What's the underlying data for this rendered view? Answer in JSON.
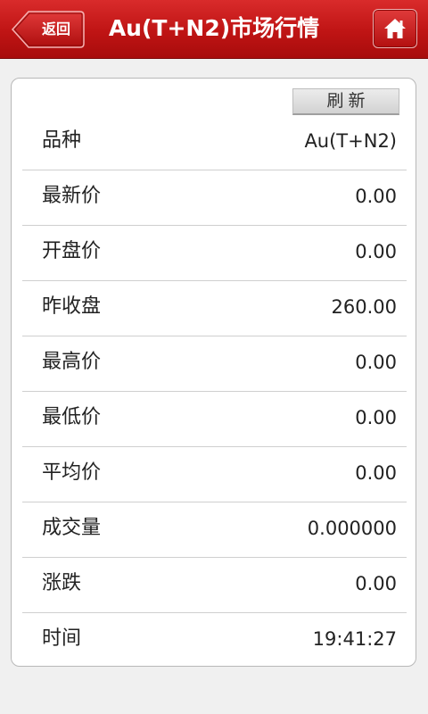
{
  "header": {
    "back_label": "返回",
    "title": "Au(T+N2)市场行情",
    "home_icon": "home-icon",
    "bar_color": "#c41a1a"
  },
  "card": {
    "refresh_label": "刷新",
    "rows": [
      {
        "label": "品种",
        "value": "Au(T+N2)"
      },
      {
        "label": "最新价",
        "value": "0.00"
      },
      {
        "label": "开盘价",
        "value": "0.00"
      },
      {
        "label": "昨收盘",
        "value": "260.00"
      },
      {
        "label": "最高价",
        "value": "0.00"
      },
      {
        "label": "最低价",
        "value": "0.00"
      },
      {
        "label": "平均价",
        "value": "0.00"
      },
      {
        "label": "成交量",
        "value": "0.000000"
      },
      {
        "label": "涨跌",
        "value": "0.00"
      },
      {
        "label": "时间",
        "value": "19:41:27"
      }
    ]
  }
}
